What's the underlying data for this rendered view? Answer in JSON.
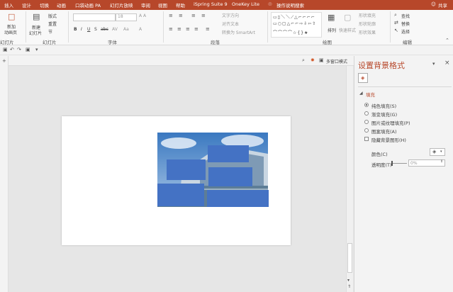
{
  "tabs": [
    "插入",
    "设计",
    "切换",
    "动画",
    "口袋动画 PA",
    "幻灯片放映",
    "审阅",
    "视图",
    "帮助",
    "iSpring Suite 9",
    "OneKey Lite"
  ],
  "tell_me": "操作说明搜索",
  "share": "共享",
  "ribbon": {
    "new_slide": "新建",
    "new_slide_sub": "幻灯片",
    "layout": "版式",
    "reset": "重置",
    "section": "节",
    "slides_group": "幻灯片",
    "font_group": "字体",
    "paragraph_group": "段落",
    "drawing_group": "绘图",
    "editing_group": "编辑",
    "text_direction": "文字方向",
    "align_text": "对齐文本",
    "convert_smartart": "转换为 SmartArt",
    "arrange": "排列",
    "quick_styles": "快速样式",
    "shape_fill": "形状填充",
    "shape_outline": "形状轮廓",
    "shape_effects": "形状效果",
    "find": "查找",
    "replace": "替换",
    "select": "选择",
    "font_size": "18",
    "new_slide_left": "新加",
    "new_slide_left_sub": "动画页",
    "slides_left": "幻灯片"
  },
  "view": {
    "zoom_label": "多窗口模式"
  },
  "pane": {
    "title": "设置背景格式",
    "section": "填充",
    "options": [
      "纯色填充(S)",
      "渐变填充(G)",
      "图片或纹理填充(P)",
      "图案填充(A)"
    ],
    "hide_bg": "隐藏背景图形(H)",
    "color_label": "颜色(C)",
    "transparency_label": "透明度(T)",
    "transparency_value": "0%"
  },
  "colors": {
    "accent": "#b7472a",
    "placeholder_blue": "#4472c4"
  }
}
